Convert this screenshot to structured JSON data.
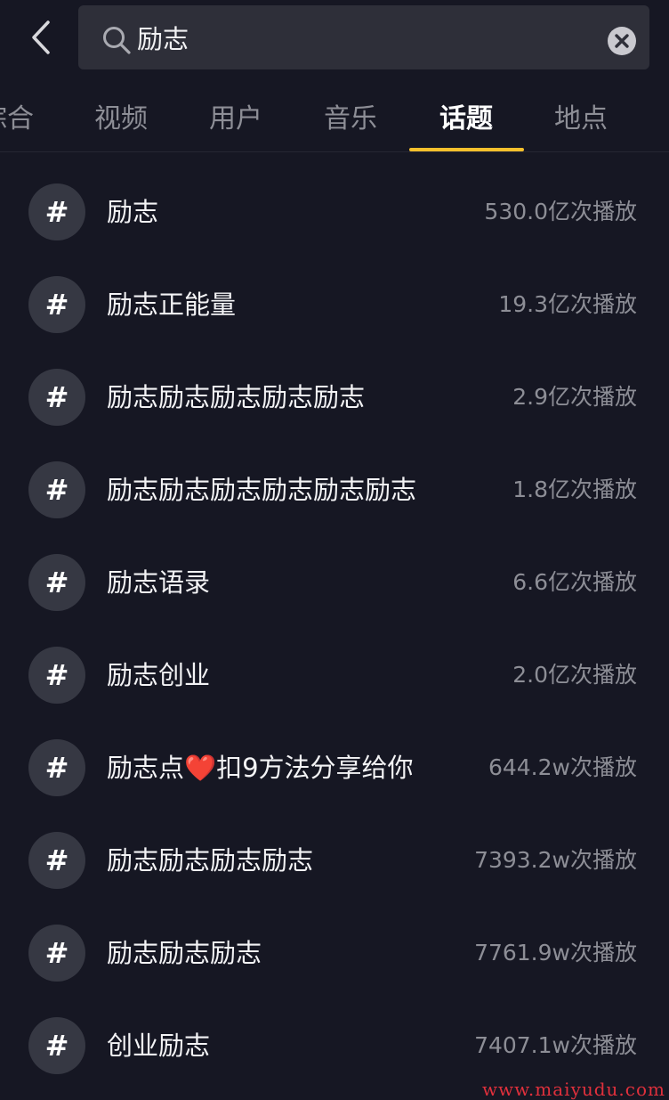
{
  "search": {
    "query": "励志"
  },
  "tabs": [
    {
      "label": "综合",
      "active": false
    },
    {
      "label": "视频",
      "active": false
    },
    {
      "label": "用户",
      "active": false
    },
    {
      "label": "音乐",
      "active": false
    },
    {
      "label": "话题",
      "active": true
    },
    {
      "label": "地点",
      "active": false
    }
  ],
  "topics": [
    {
      "icon": "#",
      "title": "励志",
      "plays": "530.0亿次播放"
    },
    {
      "icon": "#",
      "title": "励志正能量",
      "plays": "19.3亿次播放"
    },
    {
      "icon": "#",
      "title": "励志励志励志励志励志",
      "plays": "2.9亿次播放"
    },
    {
      "icon": "#",
      "title": "励志励志励志励志励志励志",
      "plays": "1.8亿次播放"
    },
    {
      "icon": "#",
      "title": "励志语录",
      "plays": "6.6亿次播放"
    },
    {
      "icon": "#",
      "title": "励志创业",
      "plays": "2.0亿次播放"
    },
    {
      "icon": "#",
      "title": "励志点❤️扣9方法分享给你",
      "plays": "644.2w次播放"
    },
    {
      "icon": "#",
      "title": "励志励志励志励志",
      "plays": "7393.2w次播放"
    },
    {
      "icon": "#",
      "title": "励志励志励志",
      "plays": "7761.9w次播放"
    },
    {
      "icon": "#",
      "title": "创业励志",
      "plays": "7407.1w次播放"
    }
  ],
  "watermark": "www.maiyudu.com",
  "colors": {
    "background": "#161723",
    "accent": "#f6c02c",
    "muted": "#8d8e96"
  }
}
